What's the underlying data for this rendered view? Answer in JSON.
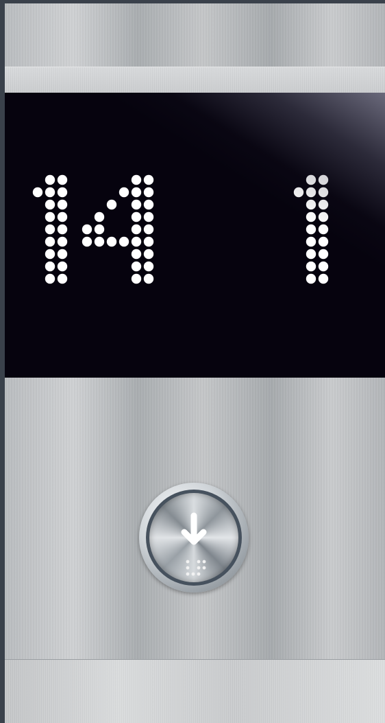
{
  "display": {
    "floor_number": "14",
    "secondary_digit": "1",
    "led_color": "#ffffff",
    "background_color": "#06030e"
  },
  "call_button": {
    "direction": "down",
    "icon": "down-arrow-icon",
    "braille": "braille-dots"
  }
}
